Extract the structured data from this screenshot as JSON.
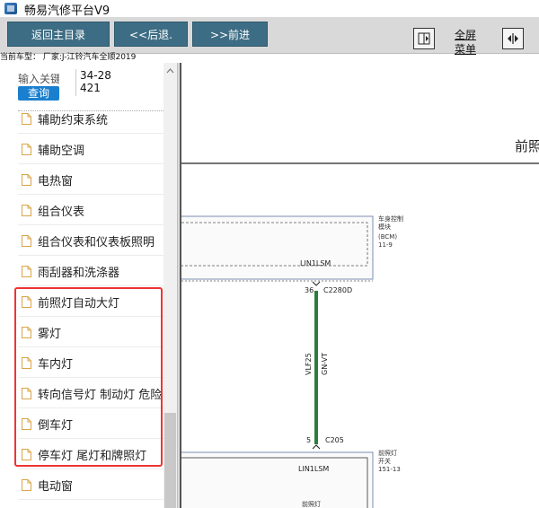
{
  "window": {
    "title": "畅易汽修平台V9"
  },
  "toolbar": {
    "back_main": "返回主目录",
    "back": "<<后退.",
    "forward": ">>前进",
    "fullscreen_line1": "全屏",
    "fullscreen_line2": "菜单"
  },
  "status": {
    "current_model": "当前车型： 厂家:J-江铃汽车全顺2019"
  },
  "sidebar": {
    "search_label": "输入关键",
    "search_value": "34-28421",
    "query_button": "查询",
    "items": [
      {
        "label": "辅助约束系统"
      },
      {
        "label": "辅助空调"
      },
      {
        "label": "电热窗"
      },
      {
        "label": "组合仪表"
      },
      {
        "label": "组合仪表和仪表板照明"
      },
      {
        "label": "雨刮器和洗涤器"
      },
      {
        "label": "前照灯自动大灯"
      },
      {
        "label": "雾灯"
      },
      {
        "label": "车内灯"
      },
      {
        "label": "转向信号灯 制动灯 危险"
      },
      {
        "label": "倒车灯"
      },
      {
        "label": "停车灯 尾灯和牌照灯"
      },
      {
        "label": "电动窗"
      }
    ]
  },
  "diagram": {
    "header_partial": "前照",
    "bcm": {
      "name_line1": "车身控制",
      "name_line2": "模块",
      "code": "(BCM)",
      "ref": "11-9",
      "pin_label": "LIN1LSM"
    },
    "connector_top": {
      "pin": "36",
      "id": "C2280D"
    },
    "wire": {
      "circuit": "VLF25",
      "color": "GN-VT"
    },
    "connector_bottom": {
      "pin": "5",
      "id": "C205"
    },
    "switch": {
      "name_line1": "前照灯",
      "name_line2": "开关",
      "ref": "151-13",
      "pin_label": "LIN1LSM",
      "bottom_label": "前照灯"
    },
    "colors": {
      "wire": "#2f7d3c",
      "module_border": "#7b8db3",
      "highlight": "#e33333"
    }
  }
}
